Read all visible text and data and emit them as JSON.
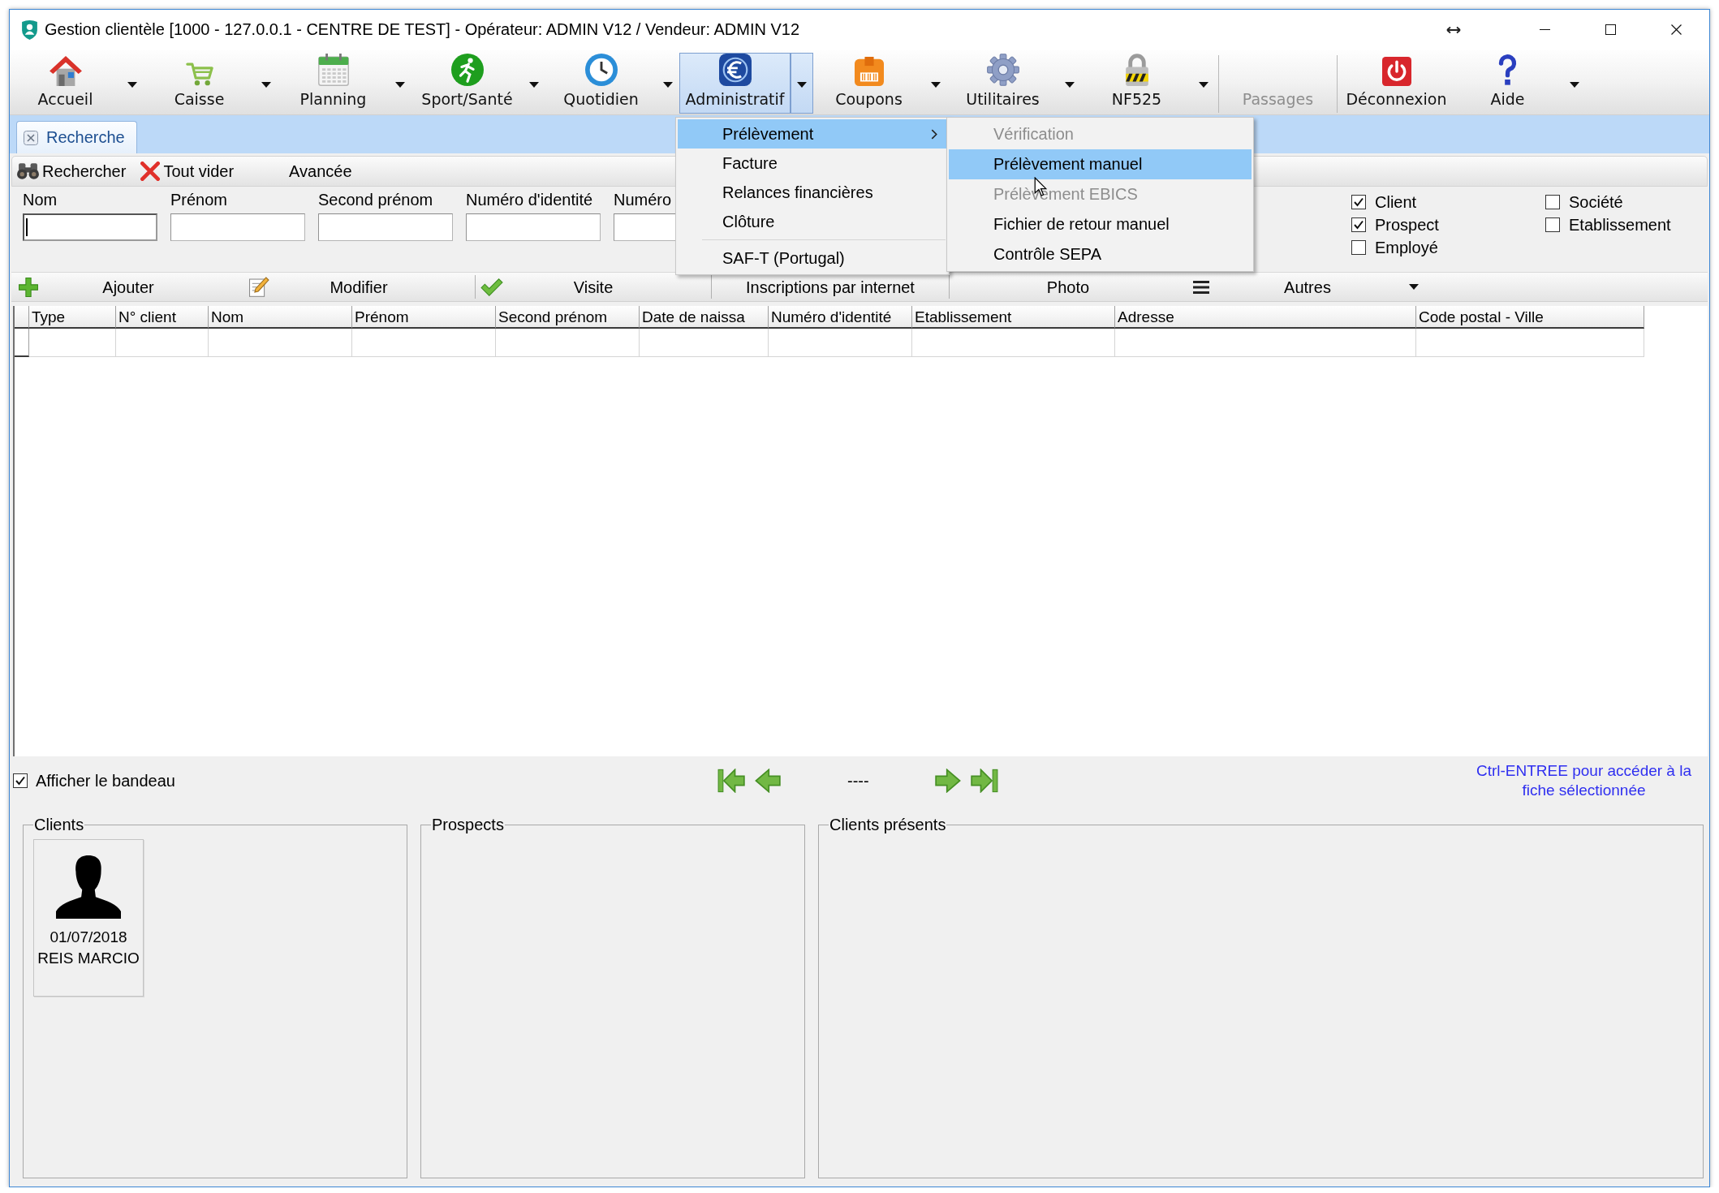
{
  "window": {
    "title": "Gestion clientèle [1000 - 127.0.0.1 - CENTRE DE TEST] - Opérateur: ADMIN V12 / Vendeur: ADMIN V12"
  },
  "toolbar": {
    "groups": [
      [
        {
          "label": "Accueil",
          "has_menu": true,
          "selected": false,
          "disabled": false
        },
        {
          "label": "Caisse",
          "has_menu": true,
          "selected": false,
          "disabled": false
        },
        {
          "label": "Planning",
          "has_menu": true,
          "selected": false,
          "disabled": false
        },
        {
          "label": "Sport/Santé",
          "has_menu": true,
          "selected": false,
          "disabled": false
        },
        {
          "label": "Quotidien",
          "has_menu": true,
          "selected": false,
          "disabled": false
        },
        {
          "label": "Administratif",
          "has_menu": true,
          "selected": true,
          "disabled": false
        },
        {
          "label": "Coupons",
          "has_menu": true,
          "selected": false,
          "disabled": false
        },
        {
          "label": "Utilitaires",
          "has_menu": true,
          "selected": false,
          "disabled": false
        },
        {
          "label": "NF525",
          "has_menu": true,
          "selected": false,
          "disabled": false
        }
      ],
      [
        {
          "label": "Passages",
          "has_menu": false,
          "selected": false,
          "disabled": true
        }
      ],
      [
        {
          "label": "Déconnexion",
          "has_menu": false,
          "selected": false,
          "disabled": false
        },
        {
          "label": "Aide",
          "has_menu": true,
          "selected": false,
          "disabled": false
        }
      ]
    ]
  },
  "tabs": [
    {
      "label": "Recherche",
      "selected": true
    }
  ],
  "search_toolbar": {
    "buttons": [
      {
        "label": "Rechercher"
      },
      {
        "label": "Tout vider"
      },
      {
        "label": "Avancée"
      }
    ]
  },
  "search_fields": [
    {
      "label": "Nom",
      "focused": true
    },
    {
      "label": "Prénom",
      "focused": false
    },
    {
      "label": "Second prénom",
      "focused": false
    },
    {
      "label": "Numéro d'identité",
      "focused": false
    },
    {
      "label": "Numéro",
      "focused": false
    }
  ],
  "filters": [
    {
      "label": "Client",
      "checked": true
    },
    {
      "label": "Prospect",
      "checked": true
    },
    {
      "label": "Employé",
      "checked": false
    },
    {
      "label": "Société",
      "checked": false
    },
    {
      "label": "Etablissement",
      "checked": false
    }
  ],
  "actions": {
    "groups": [
      [
        {
          "label": "Ajouter",
          "has_menu": false
        },
        {
          "label": "Modifier",
          "has_menu": false
        }
      ],
      [
        {
          "label": "Visite",
          "has_menu": false
        }
      ],
      [
        {
          "label": "Inscriptions par internet",
          "has_menu": false
        }
      ],
      [
        {
          "label": "Photo",
          "has_menu": false
        },
        {
          "label": "Autres",
          "has_menu": true
        }
      ]
    ]
  },
  "table": {
    "columns": [
      "Type",
      "N° client",
      "Nom",
      "Prénom",
      "Second prénom",
      "Date de naissa",
      "Numéro d'identité",
      "Etablissement",
      "Adresse",
      "Code postal - Ville"
    ]
  },
  "display_banner": {
    "label": "Afficher le bandeau",
    "checked": true
  },
  "navigation": {
    "position": "----"
  },
  "hint": "Ctrl-ENTREE pour accéder à la fiche sélectionnée",
  "panels": [
    {
      "title": "Clients",
      "cards": [
        {
          "date": "01/07/2018",
          "name": "REIS MARCIO"
        }
      ]
    },
    {
      "title": "Prospects"
    },
    {
      "title": "Clients présents"
    }
  ],
  "menu": {
    "groups": [
      [
        {
          "label": "Prélèvement",
          "selected": true,
          "has_submenu": true
        },
        {
          "label": "Facture",
          "selected": false,
          "has_submenu": false
        },
        {
          "label": "Relances financières",
          "selected": false,
          "has_submenu": false
        },
        {
          "label": "Clôture",
          "selected": false,
          "has_submenu": false
        }
      ],
      [
        {
          "label": "SAF-T (Portugal)",
          "selected": false,
          "has_submenu": false
        }
      ]
    ]
  },
  "submenu": {
    "items": [
      {
        "label": "Vérification",
        "selected": false,
        "disabled": true
      },
      {
        "label": "Prélèvement manuel",
        "selected": true,
        "disabled": false
      },
      {
        "label": "Prélèvement EBICS",
        "selected": false,
        "disabled": true
      },
      {
        "label": "Fichier de retour manuel",
        "selected": false,
        "disabled": false
      },
      {
        "label": "Contrôle SEPA",
        "selected": false,
        "disabled": false
      }
    ]
  }
}
